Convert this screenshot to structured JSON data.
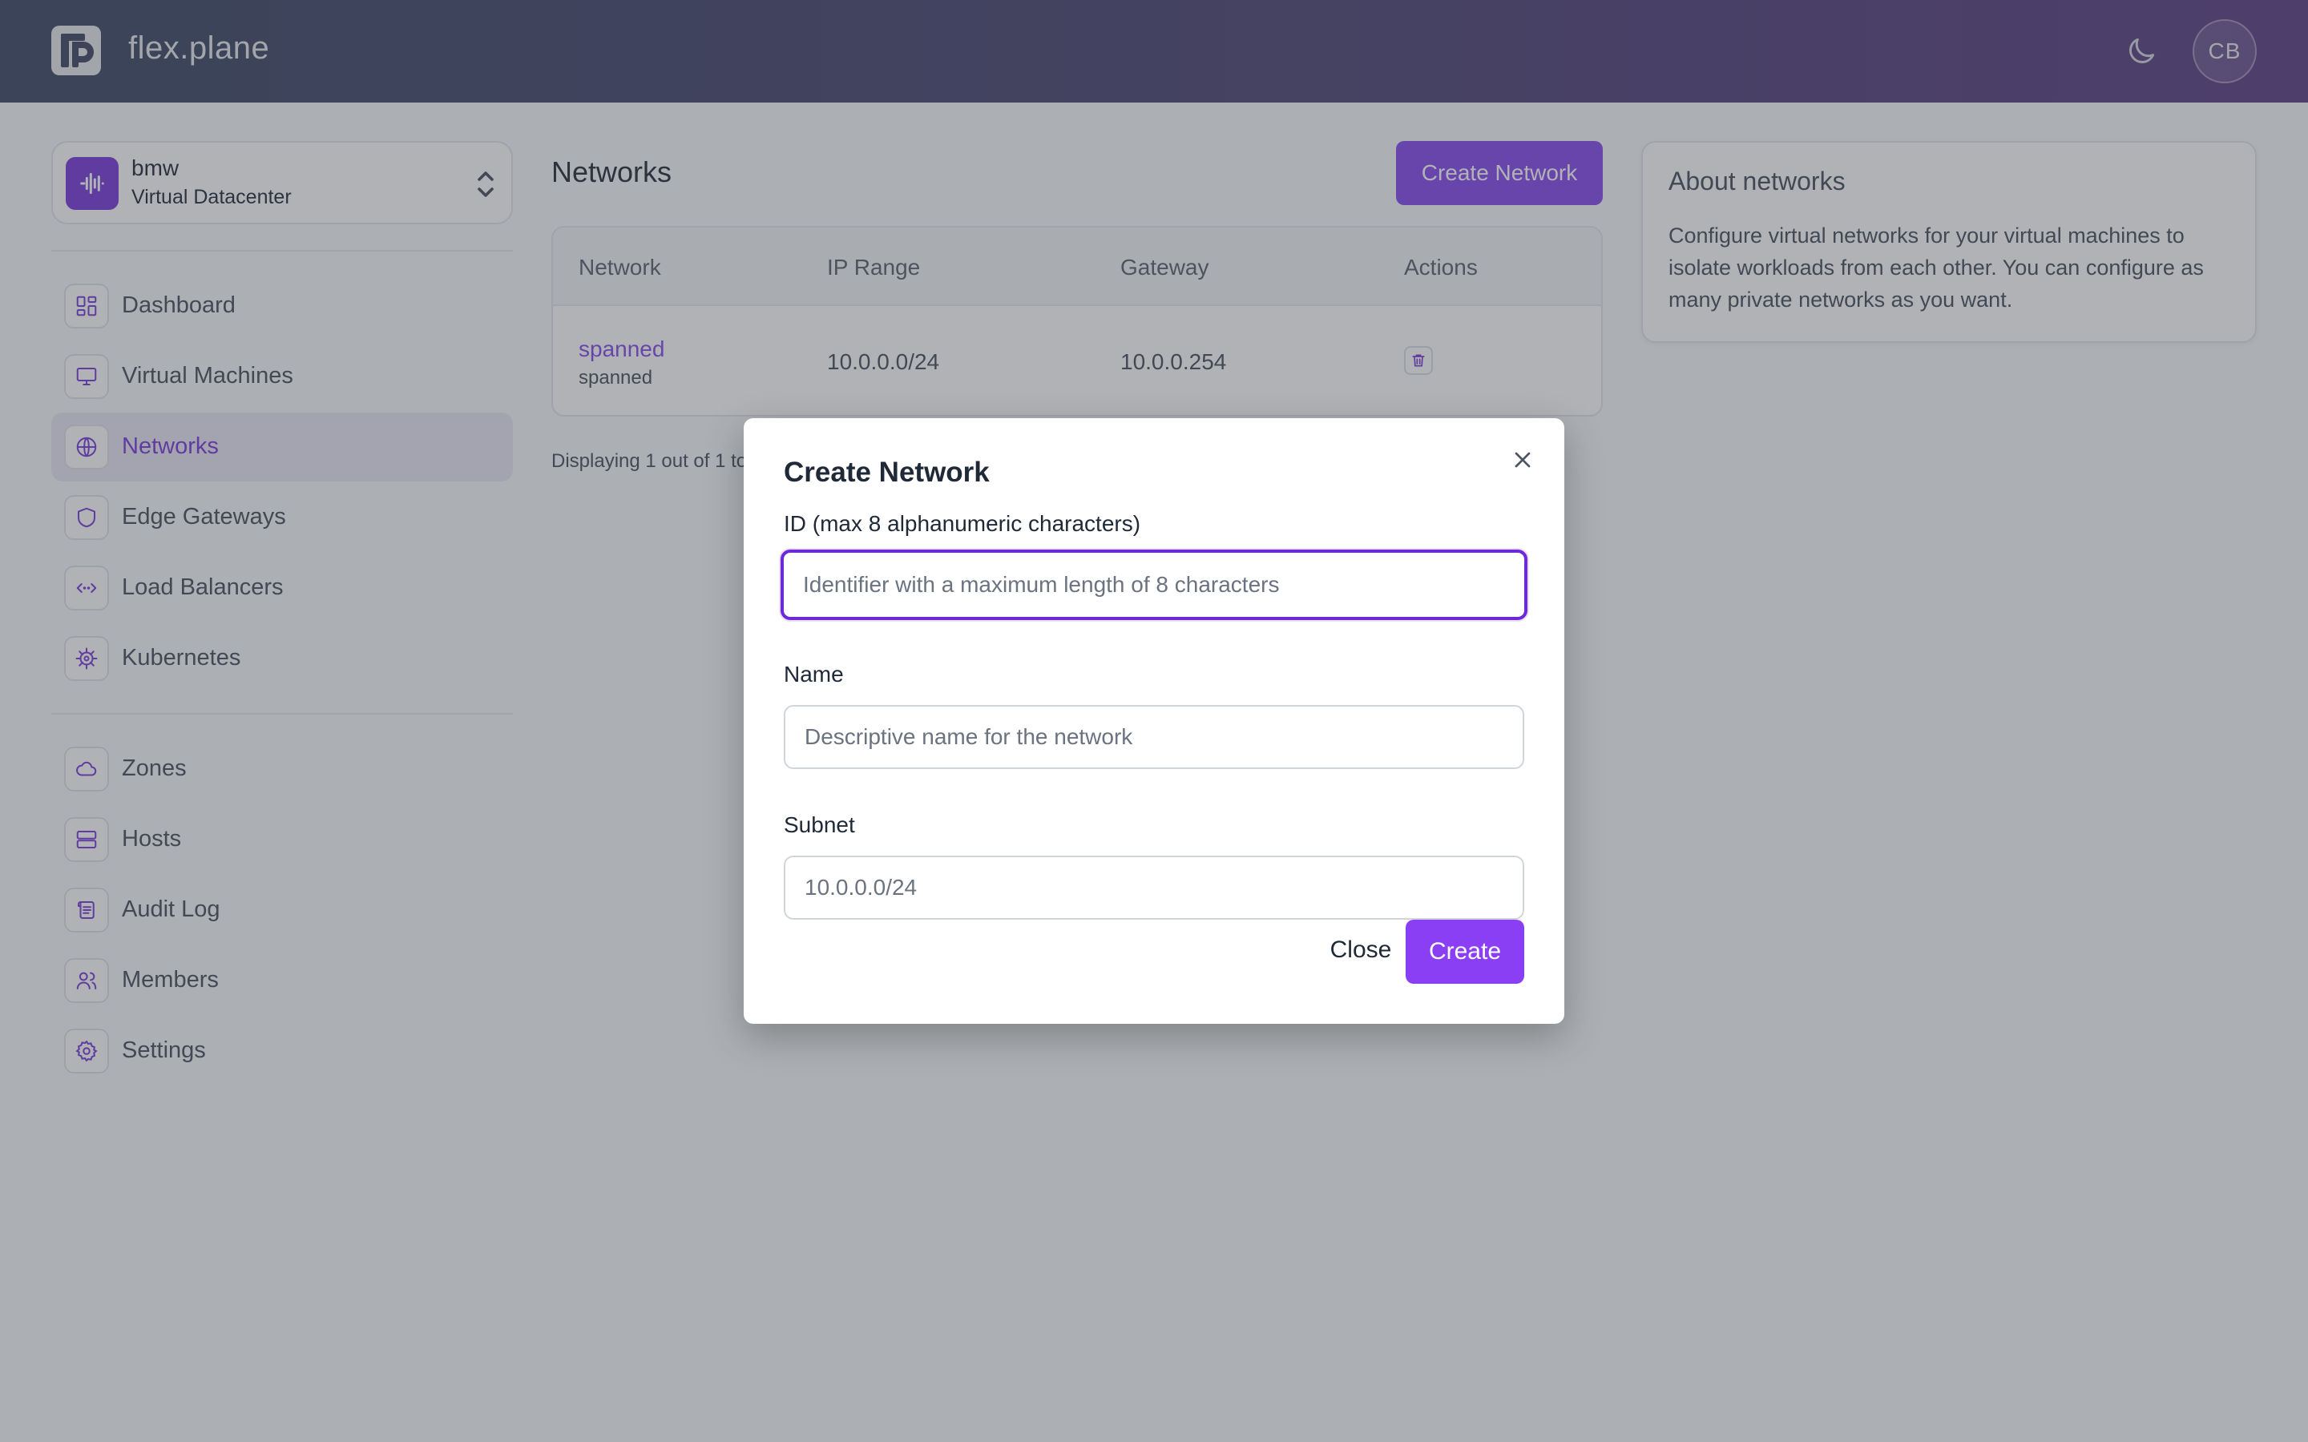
{
  "header": {
    "brand": "flex.plane",
    "avatar_initials": "CB",
    "theme_toggle_icon": "moon-icon"
  },
  "sidebar": {
    "datacenter": {
      "name": "bmw",
      "type": "Virtual Datacenter"
    },
    "primary_items": [
      {
        "label": "Dashboard",
        "icon": "dashboard-icon"
      },
      {
        "label": "Virtual Machines",
        "icon": "monitor-icon"
      },
      {
        "label": "Networks",
        "icon": "globe-icon",
        "active": true
      },
      {
        "label": "Edge Gateways",
        "icon": "shield-icon"
      },
      {
        "label": "Load Balancers",
        "icon": "code-arrows-icon"
      },
      {
        "label": "Kubernetes",
        "icon": "helm-wheel-icon"
      }
    ],
    "secondary_items": [
      {
        "label": "Zones",
        "icon": "cloud-icon"
      },
      {
        "label": "Hosts",
        "icon": "server-icon"
      },
      {
        "label": "Audit Log",
        "icon": "scroll-icon"
      },
      {
        "label": "Members",
        "icon": "users-icon"
      },
      {
        "label": "Settings",
        "icon": "gear-icon"
      }
    ]
  },
  "main": {
    "title": "Networks",
    "create_button": "Create Network",
    "table": {
      "columns": [
        "Network",
        "IP Range",
        "Gateway",
        "Actions"
      ],
      "rows": [
        {
          "name": "spanned",
          "id": "spanned",
          "ip_range": "10.0.0.0/24",
          "gateway": "10.0.0.254"
        }
      ]
    },
    "pagination_text": "Displaying 1 out of 1 to"
  },
  "about": {
    "title": "About networks",
    "text": "Configure virtual networks for your virtual machines to isolate workloads from each other. You can configure as many private networks as you want."
  },
  "modal": {
    "title": "Create Network",
    "fields": {
      "id": {
        "label": "ID (max 8 alphanumeric characters)",
        "placeholder": "Identifier with a maximum length of 8 characters",
        "value": ""
      },
      "name": {
        "label": "Name",
        "placeholder": "Descriptive name for the network",
        "value": ""
      },
      "subnet": {
        "label": "Subnet",
        "placeholder": "10.0.0.0/24",
        "value": ""
      }
    },
    "close_button": "Close",
    "create_button": "Create"
  },
  "colors": {
    "accent": "#7c3aed",
    "accent_dark": "#6d28d9",
    "header_start": "#2a3857",
    "header_end": "#4c2d7a"
  }
}
